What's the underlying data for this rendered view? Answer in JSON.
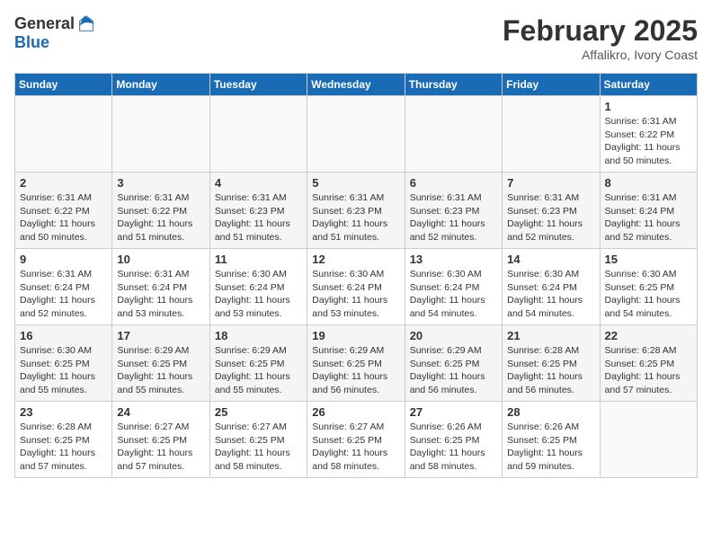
{
  "header": {
    "logo_line1": "General",
    "logo_line2": "Blue",
    "month": "February 2025",
    "location": "Affalikro, Ivory Coast"
  },
  "weekdays": [
    "Sunday",
    "Monday",
    "Tuesday",
    "Wednesday",
    "Thursday",
    "Friday",
    "Saturday"
  ],
  "weeks": [
    [
      {
        "day": "",
        "info": ""
      },
      {
        "day": "",
        "info": ""
      },
      {
        "day": "",
        "info": ""
      },
      {
        "day": "",
        "info": ""
      },
      {
        "day": "",
        "info": ""
      },
      {
        "day": "",
        "info": ""
      },
      {
        "day": "1",
        "info": "Sunrise: 6:31 AM\nSunset: 6:22 PM\nDaylight: 11 hours\nand 50 minutes."
      }
    ],
    [
      {
        "day": "2",
        "info": "Sunrise: 6:31 AM\nSunset: 6:22 PM\nDaylight: 11 hours\nand 50 minutes."
      },
      {
        "day": "3",
        "info": "Sunrise: 6:31 AM\nSunset: 6:22 PM\nDaylight: 11 hours\nand 51 minutes."
      },
      {
        "day": "4",
        "info": "Sunrise: 6:31 AM\nSunset: 6:23 PM\nDaylight: 11 hours\nand 51 minutes."
      },
      {
        "day": "5",
        "info": "Sunrise: 6:31 AM\nSunset: 6:23 PM\nDaylight: 11 hours\nand 51 minutes."
      },
      {
        "day": "6",
        "info": "Sunrise: 6:31 AM\nSunset: 6:23 PM\nDaylight: 11 hours\nand 52 minutes."
      },
      {
        "day": "7",
        "info": "Sunrise: 6:31 AM\nSunset: 6:23 PM\nDaylight: 11 hours\nand 52 minutes."
      },
      {
        "day": "8",
        "info": "Sunrise: 6:31 AM\nSunset: 6:24 PM\nDaylight: 11 hours\nand 52 minutes."
      }
    ],
    [
      {
        "day": "9",
        "info": "Sunrise: 6:31 AM\nSunset: 6:24 PM\nDaylight: 11 hours\nand 52 minutes."
      },
      {
        "day": "10",
        "info": "Sunrise: 6:31 AM\nSunset: 6:24 PM\nDaylight: 11 hours\nand 53 minutes."
      },
      {
        "day": "11",
        "info": "Sunrise: 6:30 AM\nSunset: 6:24 PM\nDaylight: 11 hours\nand 53 minutes."
      },
      {
        "day": "12",
        "info": "Sunrise: 6:30 AM\nSunset: 6:24 PM\nDaylight: 11 hours\nand 53 minutes."
      },
      {
        "day": "13",
        "info": "Sunrise: 6:30 AM\nSunset: 6:24 PM\nDaylight: 11 hours\nand 54 minutes."
      },
      {
        "day": "14",
        "info": "Sunrise: 6:30 AM\nSunset: 6:24 PM\nDaylight: 11 hours\nand 54 minutes."
      },
      {
        "day": "15",
        "info": "Sunrise: 6:30 AM\nSunset: 6:25 PM\nDaylight: 11 hours\nand 54 minutes."
      }
    ],
    [
      {
        "day": "16",
        "info": "Sunrise: 6:30 AM\nSunset: 6:25 PM\nDaylight: 11 hours\nand 55 minutes."
      },
      {
        "day": "17",
        "info": "Sunrise: 6:29 AM\nSunset: 6:25 PM\nDaylight: 11 hours\nand 55 minutes."
      },
      {
        "day": "18",
        "info": "Sunrise: 6:29 AM\nSunset: 6:25 PM\nDaylight: 11 hours\nand 55 minutes."
      },
      {
        "day": "19",
        "info": "Sunrise: 6:29 AM\nSunset: 6:25 PM\nDaylight: 11 hours\nand 56 minutes."
      },
      {
        "day": "20",
        "info": "Sunrise: 6:29 AM\nSunset: 6:25 PM\nDaylight: 11 hours\nand 56 minutes."
      },
      {
        "day": "21",
        "info": "Sunrise: 6:28 AM\nSunset: 6:25 PM\nDaylight: 11 hours\nand 56 minutes."
      },
      {
        "day": "22",
        "info": "Sunrise: 6:28 AM\nSunset: 6:25 PM\nDaylight: 11 hours\nand 57 minutes."
      }
    ],
    [
      {
        "day": "23",
        "info": "Sunrise: 6:28 AM\nSunset: 6:25 PM\nDaylight: 11 hours\nand 57 minutes."
      },
      {
        "day": "24",
        "info": "Sunrise: 6:27 AM\nSunset: 6:25 PM\nDaylight: 11 hours\nand 57 minutes."
      },
      {
        "day": "25",
        "info": "Sunrise: 6:27 AM\nSunset: 6:25 PM\nDaylight: 11 hours\nand 58 minutes."
      },
      {
        "day": "26",
        "info": "Sunrise: 6:27 AM\nSunset: 6:25 PM\nDaylight: 11 hours\nand 58 minutes."
      },
      {
        "day": "27",
        "info": "Sunrise: 6:26 AM\nSunset: 6:25 PM\nDaylight: 11 hours\nand 58 minutes."
      },
      {
        "day": "28",
        "info": "Sunrise: 6:26 AM\nSunset: 6:25 PM\nDaylight: 11 hours\nand 59 minutes."
      },
      {
        "day": "",
        "info": ""
      }
    ]
  ]
}
